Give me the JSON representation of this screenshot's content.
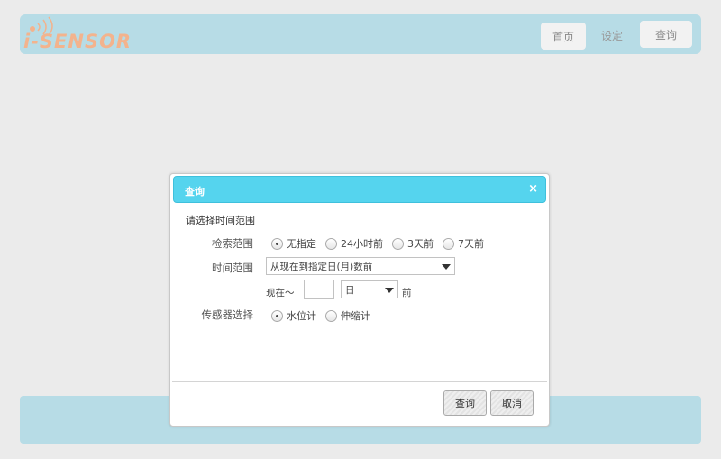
{
  "header": {
    "logo_text": "i-SENSOR",
    "nav": {
      "home": "首页",
      "settings": "设定",
      "query": "查询"
    }
  },
  "dialog": {
    "title": "查询",
    "close_icon": "×",
    "section_title": "请选择时间范围",
    "search_range": {
      "label": "检索范围",
      "options": [
        "无指定",
        "24小时前",
        "3天前",
        "7天前"
      ],
      "selected": "无指定"
    },
    "time_range": {
      "label": "时间范围",
      "selected": "从现在到指定日(月)数前",
      "now_prefix": "现在～",
      "count_value": "",
      "unit_selected": "日",
      "suffix": "前"
    },
    "sensor_select": {
      "label": "传感器选择",
      "options": [
        "水位计",
        "伸缩计"
      ],
      "selected": "水位计"
    },
    "buttons": {
      "search": "查询",
      "cancel": "取消"
    }
  },
  "colors": {
    "header_bg": "#b7dce6",
    "titlebar_bg": "#55d4ee",
    "logo_color": "#f3b38d",
    "page_bg": "#ebebeb"
  }
}
